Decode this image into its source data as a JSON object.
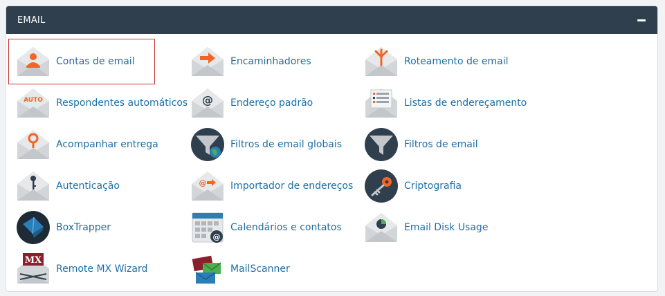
{
  "section": {
    "title": "EMAIL",
    "collapse_icon": "minus-icon"
  },
  "colors": {
    "header_bg": "#2f3f4e",
    "link": "#1b6fa8",
    "accent": "#f26522",
    "selection": "#c9302c"
  },
  "items": [
    {
      "label": "Contas de email",
      "icon": "user-envelope-icon"
    },
    {
      "label": "Encaminhadores",
      "icon": "forward-envelope-icon"
    },
    {
      "label": "Roteamento de email",
      "icon": "route-envelope-icon"
    },
    {
      "label": "Respondentes automáticos",
      "icon": "auto-envelope-icon",
      "icon_text": "AUTO"
    },
    {
      "label": "Endereço padrão",
      "icon": "at-envelope-icon",
      "icon_text": "@"
    },
    {
      "label": "Listas de endereçamento",
      "icon": "list-envelope-icon"
    },
    {
      "label": "Acompanhar entrega",
      "icon": "pin-envelope-icon"
    },
    {
      "label": "Filtros de email globais",
      "icon": "global-filter-icon"
    },
    {
      "label": "Filtros de email",
      "icon": "filter-icon"
    },
    {
      "label": "Autenticação",
      "icon": "key-envelope-icon"
    },
    {
      "label": "Importador de endereços",
      "icon": "import-envelope-icon",
      "icon_text": "@"
    },
    {
      "label": "Criptografia",
      "icon": "encryption-key-icon"
    },
    {
      "label": "BoxTrapper",
      "icon": "boxtrapper-icon"
    },
    {
      "label": "Calendários e contatos",
      "icon": "calendar-icon",
      "icon_text": "@"
    },
    {
      "label": "Email Disk Usage",
      "icon": "disk-usage-envelope-icon"
    },
    {
      "label": "Remote MX Wizard",
      "icon": "mx-wizard-icon",
      "icon_text": "MX"
    },
    {
      "label": "MailScanner",
      "icon": "mailscanner-icon"
    }
  ]
}
